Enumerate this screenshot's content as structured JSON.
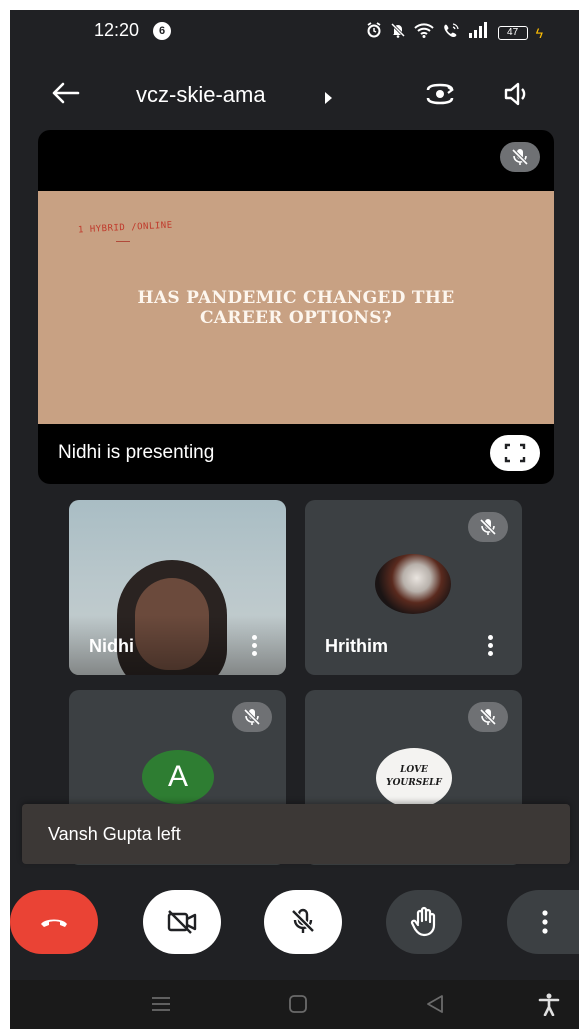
{
  "status_bar": {
    "time": "12:20",
    "notification_count": "6",
    "battery_level": "47",
    "icons": [
      "alarm-icon",
      "bell-off-icon",
      "wifi-icon",
      "wifi-call-icon",
      "signal-icon",
      "battery-icon",
      "charging-icon"
    ]
  },
  "header": {
    "meeting_code": "vcz-skie-ama",
    "icons": [
      "back-arrow-icon",
      "meeting-info-caret-icon",
      "switch-camera-icon",
      "speaker-icon"
    ]
  },
  "presentation": {
    "slide_note": "1 HYBRID /ONLINE",
    "slide_title_line1": "HAS PANDEMIC CHANGED THE",
    "slide_title_line2": "CAREER OPTIONS?",
    "presenter_label": "Nidhi is presenting"
  },
  "participants": [
    {
      "name": "Nidhi",
      "muted": false,
      "media": "video"
    },
    {
      "name": "Hrithim",
      "muted": true,
      "media": "avatar-image"
    },
    {
      "name": "",
      "avatar_letter": "A",
      "muted": true,
      "media": "avatar-letter"
    },
    {
      "name": "",
      "avatar_text_line1": "LOVE",
      "avatar_text_line2": "YOURSELF",
      "muted": true,
      "media": "avatar-image"
    }
  ],
  "toast": {
    "message": "Vansh Gupta left"
  },
  "controls": [
    {
      "name": "end-call",
      "icon": "phone-hangup-icon",
      "color": "#ea4335"
    },
    {
      "name": "camera",
      "icon": "camera-off-icon",
      "state": "off"
    },
    {
      "name": "microphone",
      "icon": "mic-off-icon",
      "state": "off"
    },
    {
      "name": "raise-hand",
      "icon": "hand-icon"
    },
    {
      "name": "more-options",
      "icon": "more-vertical-icon"
    }
  ],
  "nav_bar": {
    "icons": [
      "recents-icon",
      "home-icon",
      "back-icon",
      "accessibility-icon"
    ]
  },
  "colors": {
    "background": "#202124",
    "tile": "#3c4043",
    "slide": "#c8a183",
    "end_call": "#ea4335",
    "avatar_green": "#2e7d32",
    "charging": "#fbbc04"
  }
}
